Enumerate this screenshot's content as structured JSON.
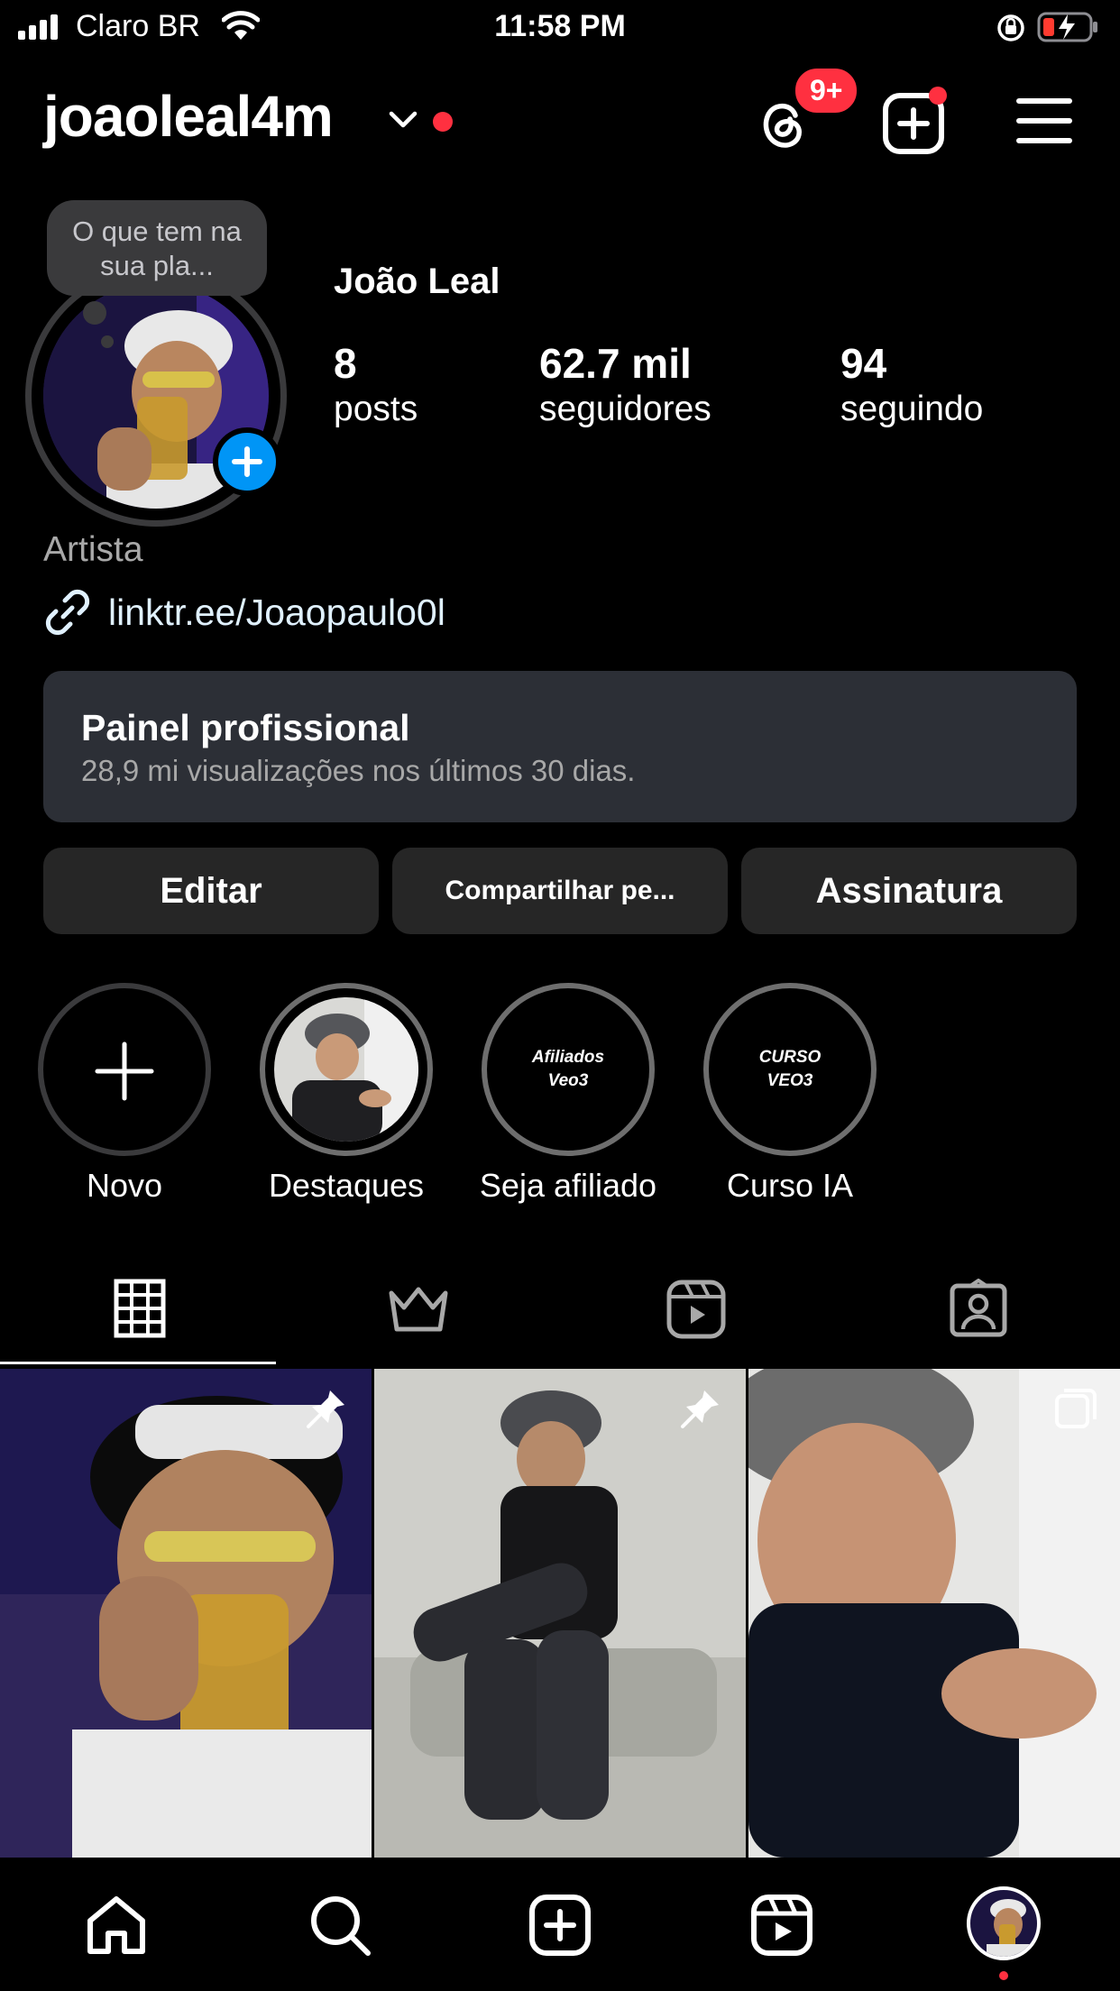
{
  "status_bar": {
    "carrier": "Claro BR",
    "time": "11:58 PM"
  },
  "header": {
    "username": "joaoleal4m",
    "threads_badge": "9+",
    "icons": [
      "chevron-down-icon",
      "threads-icon",
      "create-post-icon",
      "menu-icon"
    ]
  },
  "profile": {
    "note_text": "O que tem na sua pla...",
    "full_name": "João Leal",
    "stats": [
      {
        "value": "8",
        "label": "posts"
      },
      {
        "value": "62.7 mil",
        "label": "seguidores"
      },
      {
        "value": "94",
        "label": "seguindo"
      }
    ],
    "category": "Artista",
    "link": "linktr.ee/Joaopaulo0l"
  },
  "dashboard": {
    "title": "Painel profissional",
    "subtitle": "28,9 mi visualizações nos últimos 30 dias."
  },
  "actions": {
    "edit": "Editar",
    "share": "Compartilhar pe...",
    "subscription": "Assinatura"
  },
  "highlights": [
    {
      "label": "Novo",
      "cover_text": ""
    },
    {
      "label": "Destaques",
      "cover_text": ""
    },
    {
      "label": "Seja afiliado",
      "cover_text": "Afiliados Veo3"
    },
    {
      "label": "Curso IA",
      "cover_text": "CURSO VEO3"
    }
  ],
  "tabs": [
    "grid-icon",
    "crown-icon",
    "reels-icon",
    "tagged-icon"
  ],
  "colors": {
    "accent_red": "#ff3040",
    "accent_blue": "#0095f6",
    "panel_bg": "#2c2f36",
    "button_bg": "#262626"
  }
}
